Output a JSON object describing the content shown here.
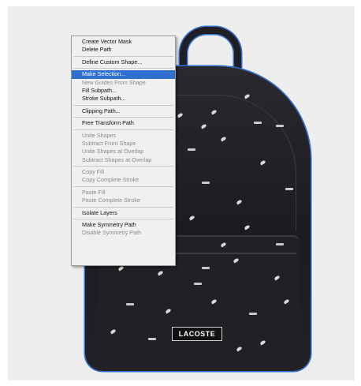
{
  "menu": {
    "groups": [
      [
        {
          "label": "Create Vector Mask",
          "disabled": false
        },
        {
          "label": "Delete Path",
          "disabled": false
        }
      ],
      [
        {
          "label": "Define Custom Shape...",
          "disabled": false
        }
      ],
      [
        {
          "label": "Make Selection...",
          "disabled": false,
          "highlighted": true
        },
        {
          "label": "New Guides From Shape",
          "disabled": true
        },
        {
          "label": "Fill Subpath...",
          "disabled": false
        },
        {
          "label": "Stroke Subpath...",
          "disabled": false
        }
      ],
      [
        {
          "label": "Clipping Path...",
          "disabled": false
        }
      ],
      [
        {
          "label": "Free Transform Path",
          "disabled": false
        }
      ],
      [
        {
          "label": "Unite Shapes",
          "disabled": true
        },
        {
          "label": "Subtract Front Shape",
          "disabled": true
        },
        {
          "label": "Unite Shapes at Overlap",
          "disabled": true
        },
        {
          "label": "Subtract Shapes at Overlap",
          "disabled": true
        }
      ],
      [
        {
          "label": "Copy Fill",
          "disabled": true
        },
        {
          "label": "Copy Complete Stroke",
          "disabled": true
        }
      ],
      [
        {
          "label": "Paste Fill",
          "disabled": true
        },
        {
          "label": "Paste Complete Stroke",
          "disabled": true
        }
      ],
      [
        {
          "label": "Isolate Layers",
          "disabled": false
        }
      ],
      [
        {
          "label": "Make Symmetry Path",
          "disabled": false
        },
        {
          "label": "Disable Symmetry Path",
          "disabled": true
        }
      ]
    ]
  },
  "backpack": {
    "brand_label": "LACOSTE"
  },
  "colors": {
    "selection_highlight": "#2f6fd0",
    "path_outline": "#2e6fd6",
    "canvas_bg": "#eeeeee"
  }
}
